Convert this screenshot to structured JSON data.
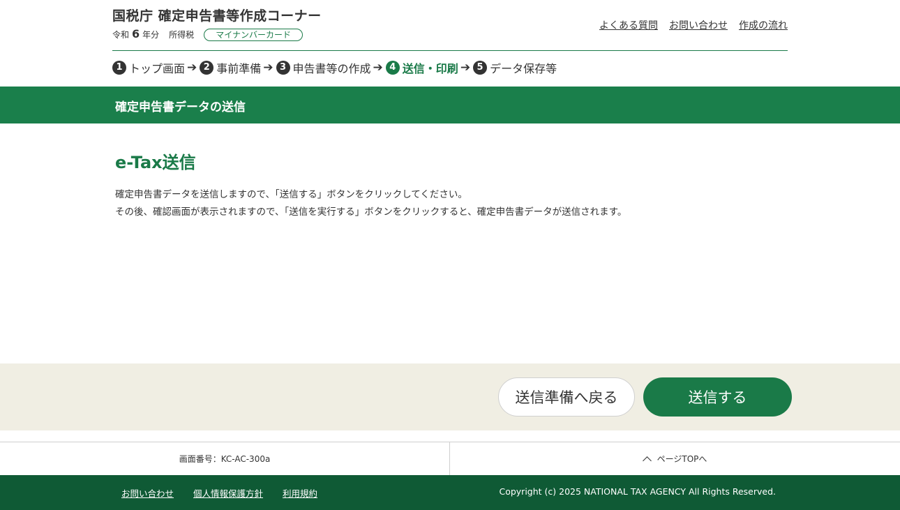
{
  "header": {
    "site_title": "国税庁 確定申告書等作成コーナー",
    "year_prefix": "令和",
    "year_number": "6",
    "year_suffix": "年分",
    "tax_type": "所得税",
    "method_badge": "マイナンバーカード",
    "links": [
      "よくある質問",
      "お問い合わせ",
      "作成の流れ"
    ]
  },
  "steps": [
    {
      "num": "1",
      "label": "トップ画面"
    },
    {
      "num": "2",
      "label": "事前準備"
    },
    {
      "num": "3",
      "label": "申告書等の作成"
    },
    {
      "num": "4",
      "label": "送信・印刷",
      "current": true
    },
    {
      "num": "5",
      "label": "データ保存等"
    }
  ],
  "step_arrow": "➔",
  "page_band_title": "確定申告書データの送信",
  "main": {
    "title": "e-Tax送信",
    "description_lines": [
      "確定申告書データを送信しますので、「送信する」ボタンをクリックしてください。",
      "その後、確認画面が表示されますので、「送信を実行する」ボタンをクリックすると、確定申告書データが送信されます。"
    ]
  },
  "actions": {
    "back_label": "送信準備へ戻る",
    "send_label": "送信する"
  },
  "info_row": {
    "screen_id": "画面番号：KC-AC-300a",
    "page_top": "ページTOPへ"
  },
  "footer": {
    "links": [
      "お問い合わせ",
      "個人情報保護方針",
      "利用規約"
    ],
    "copyright": "Copyright (c)  2025 NATIONAL TAX AGENCY All Rights Reserved."
  },
  "colors": {
    "brand_green": "#1a7a48",
    "band_green": "#1a7f4b",
    "footer_green": "#0f5a35",
    "action_band": "#f0eee3"
  }
}
